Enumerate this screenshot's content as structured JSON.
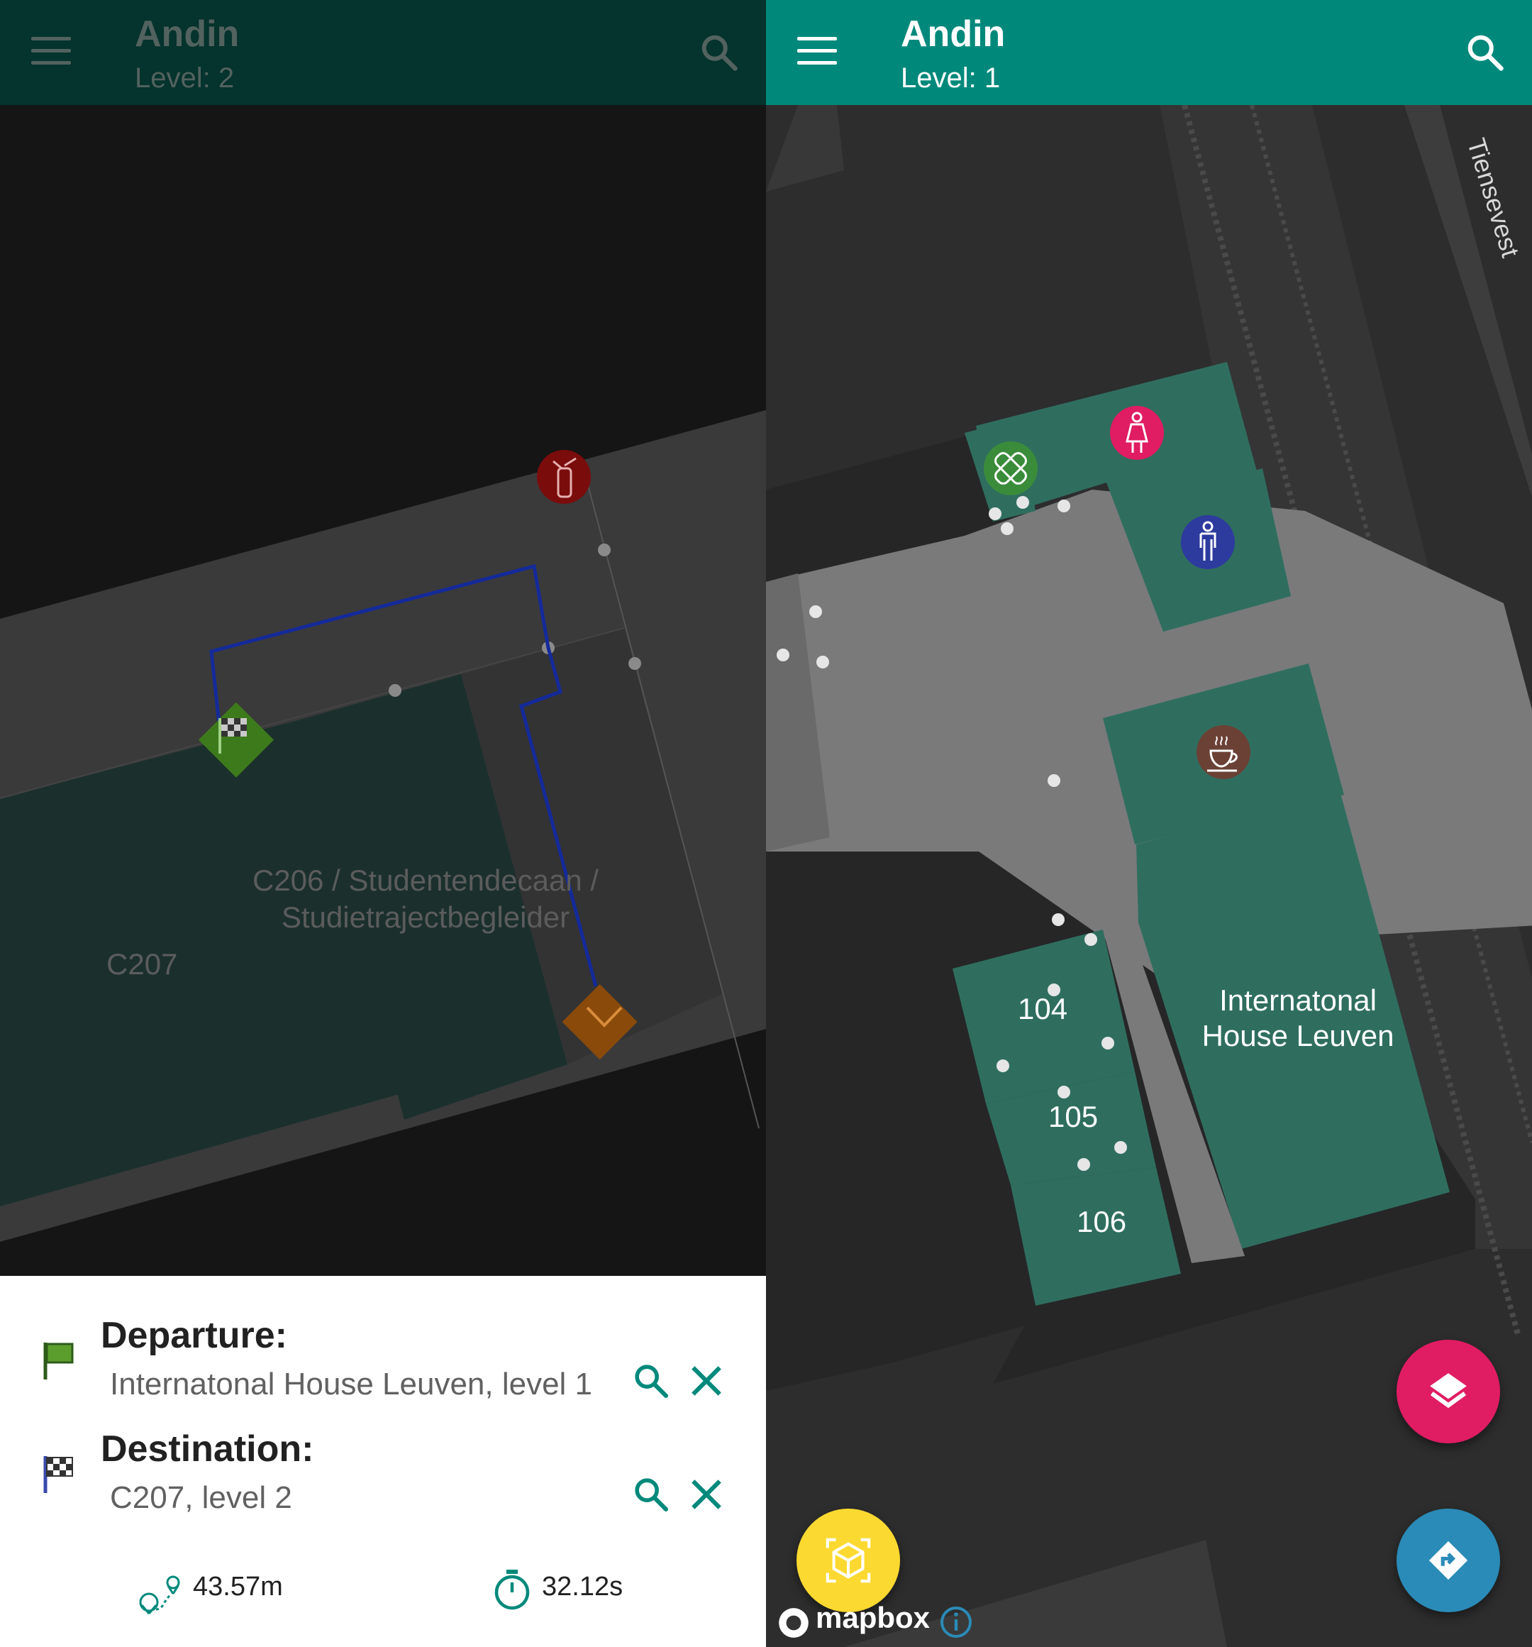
{
  "left": {
    "appbar": {
      "title": "Andin",
      "level": "Level: 2"
    },
    "map_labels": {
      "room_c206": "C206 / Studentendecaan /",
      "room_c206_line2": "Studietrajectbegleider",
      "room_c207": "C207"
    },
    "icons": {
      "extinguisher": "fire-extinguisher-icon",
      "start": "checkered-flag-icon",
      "end": "chevron-down-icon"
    },
    "route": {
      "departure_label": "Departure:",
      "departure_value": "Internatonal House Leuven, level 1",
      "destination_label": "Destination:",
      "destination_value": "C207, level 2",
      "distance": "43.57m",
      "duration": "32.12s"
    }
  },
  "right": {
    "appbar": {
      "title": "Andin",
      "level": "Level: 1"
    },
    "map_labels": {
      "street": "Tiensevest",
      "room_104": "104",
      "room_105": "105",
      "room_106": "106",
      "building": "Internatonal",
      "building_line2": "House Leuven"
    },
    "icons": {
      "first_aid": "first-aid-icon",
      "female": "female-toilet-icon",
      "male": "male-toilet-icon",
      "cafe": "coffee-icon"
    },
    "attribution": "mapbox"
  },
  "colors": {
    "teal": "#00897b",
    "room": "#2f6e5f",
    "pink": "#e01c62",
    "blue": "#2a8bb8",
    "yellow": "#fcd930"
  }
}
